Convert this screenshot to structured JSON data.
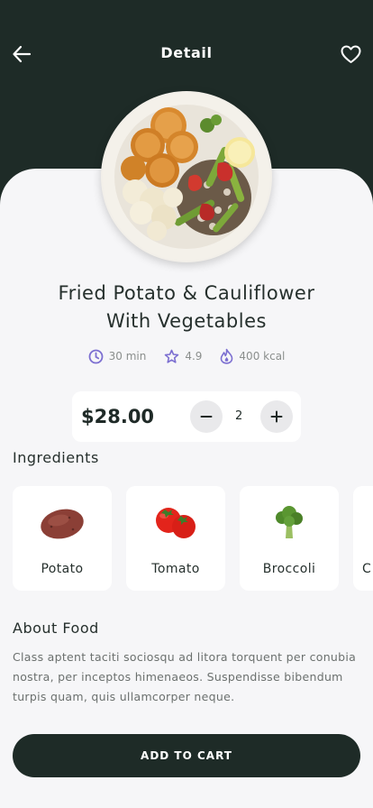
{
  "header": {
    "title": "Detail",
    "back_icon": "arrow-left-icon",
    "favorite_icon": "heart-icon"
  },
  "food": {
    "name_line1": "Fried Potato & Cauliflower",
    "name_line2": "With Vegetables",
    "time": "30 min",
    "rating": "4.9",
    "calories": "400 kcal",
    "meta_color": "#7c6fd1"
  },
  "order": {
    "price": "$28.00",
    "quantity": "2"
  },
  "ingredients": {
    "title": "Ingredients",
    "items": [
      {
        "name": "Potato",
        "icon": "potato-icon"
      },
      {
        "name": "Tomato",
        "icon": "tomato-icon"
      },
      {
        "name": "Broccoli",
        "icon": "broccoli-icon"
      },
      {
        "name": "C",
        "icon": ""
      }
    ]
  },
  "about": {
    "title": "About Food",
    "text": "Class aptent taciti sociosqu ad litora torquent per conubia nostra, per inceptos himenaeos. Suspendisse bibendum turpis quam, quis ullamcorper neque."
  },
  "cart": {
    "label": "ADD TO CART"
  },
  "colors": {
    "dark": "#1e2b27",
    "background": "#f6f6f8",
    "accent": "#7c6fd1"
  }
}
